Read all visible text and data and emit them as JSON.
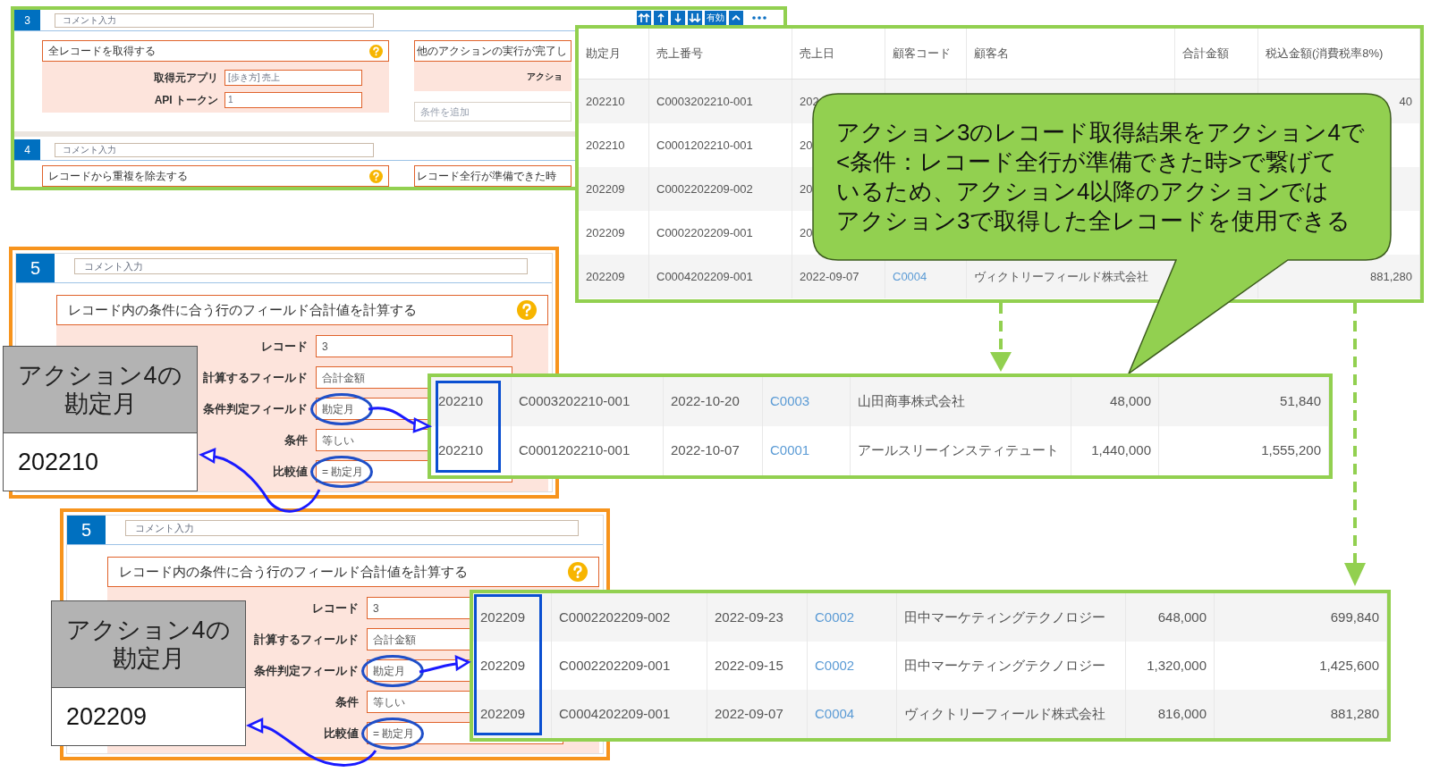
{
  "automation_panel": {
    "actions": [
      {
        "number": "3",
        "comment_placeholder": "コメント入力",
        "left": {
          "title": "全レコードを取得する",
          "fields": [
            {
              "label": "取得元アプリ",
              "value": "[歩き方] 売上"
            },
            {
              "label": "API トークン",
              "value": "1"
            }
          ]
        },
        "right": {
          "title": "他のアクションの実行が完了し",
          "label": "アクショ",
          "condition_placeholder": "条件を追加"
        }
      },
      {
        "number": "4",
        "comment_placeholder": "コメント入力",
        "left": {
          "title": "レコードから重複を除去する"
        },
        "right": {
          "title": "レコード全行が準備できた時"
        }
      }
    ],
    "toolbar": [
      {
        "kind": "move-top"
      },
      {
        "kind": "move-up"
      },
      {
        "kind": "move-down"
      },
      {
        "kind": "move-bottom"
      },
      {
        "kind": "toggle",
        "label": "有効"
      },
      {
        "kind": "collapse"
      },
      {
        "kind": "more"
      }
    ]
  },
  "record_table": {
    "columns": [
      "勘定月",
      "売上番号",
      "売上日",
      "顧客コード",
      "顧客名",
      "合計金額",
      "税込金額(消費税率8%)"
    ],
    "rows": [
      {
        "cells": [
          "202210",
          "C0003202210-001",
          "202"
        ],
        "last": "40"
      },
      {
        "cells": [
          "202210",
          "C0001202210-001",
          "20"
        ]
      },
      {
        "cells": [
          "202209",
          "C0002202209-002",
          "20"
        ]
      },
      {
        "cells": [
          "202209",
          "C0002202209-001",
          "20"
        ]
      },
      {
        "cells": [
          "202209",
          "C0004202209-001",
          "2022-09-07",
          "C0004",
          "ヴィクトリーフィールド株式会社",
          "",
          "881,280"
        ]
      }
    ]
  },
  "callout": {
    "lines": [
      "アクション3のレコード取得結果をアクション4で",
      "<条件：レコード全行が準備できた時>で繋げて",
      "いるため、アクション4以降のアクションでは",
      "アクション3で取得した全レコードを使用できる"
    ]
  },
  "calc_panels": [
    {
      "number": "5",
      "comment_placeholder": "コメント入力",
      "title": "レコード内の条件に合う行のフィールド合計値を計算する",
      "fields": [
        {
          "label": "レコード",
          "value": "3",
          "circled": false
        },
        {
          "label": "計算するフィールド",
          "value": "合計金額",
          "circled": false
        },
        {
          "label": "条件判定フィールド",
          "value": "勘定月",
          "circled": true
        },
        {
          "label": "条件",
          "value": "等しい",
          "circled": false
        },
        {
          "label": "比較値",
          "value": "= 勘定月",
          "circled": true
        }
      ],
      "note": {
        "title_lines": [
          "アクション4の",
          "勘定月"
        ],
        "value": "202210"
      },
      "result_rows": [
        [
          "202210",
          "C0003202210-001",
          "2022-10-20",
          "C0003",
          "山田商事株式会社",
          "48,000",
          "51,840"
        ],
        [
          "202210",
          "C0001202210-001",
          "2022-10-07",
          "C0001",
          "アールスリーインスティテュート",
          "1,440,000",
          "1,555,200"
        ]
      ]
    },
    {
      "number": "5",
      "comment_placeholder": "コメント入力",
      "title": "レコード内の条件に合う行のフィールド合計値を計算する",
      "fields": [
        {
          "label": "レコード",
          "value": "3",
          "circled": false
        },
        {
          "label": "計算するフィールド",
          "value": "合計金額",
          "circled": false
        },
        {
          "label": "条件判定フィールド",
          "value": "勘定月",
          "circled": true
        },
        {
          "label": "条件",
          "value": "等しい",
          "circled": false
        },
        {
          "label": "比較値",
          "value": "= 勘定月",
          "circled": true
        }
      ],
      "note": {
        "title_lines": [
          "アクション4の",
          "勘定月"
        ],
        "value": "202209"
      },
      "result_rows": [
        [
          "202209",
          "C0002202209-002",
          "2022-09-23",
          "C0002",
          "田中マーケティングテクノロジー",
          "648,000",
          "699,840"
        ],
        [
          "202209",
          "C0002202209-001",
          "2022-09-15",
          "C0002",
          "田中マーケティングテクノロジー",
          "1,320,000",
          "1,425,600"
        ],
        [
          "202209",
          "C0004202209-001",
          "2022-09-07",
          "C0004",
          "ヴィクトリーフィールド株式会社",
          "816,000",
          "881,280"
        ]
      ]
    }
  ]
}
